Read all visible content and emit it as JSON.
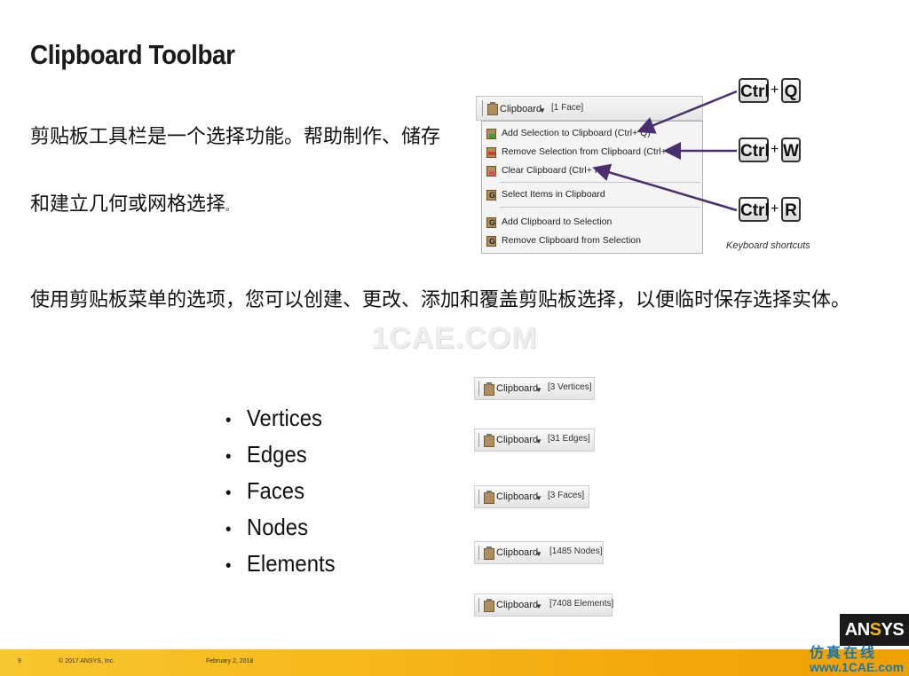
{
  "title": "Clipboard Toolbar",
  "intro_line1": "剪贴板工具栏是一个选择功能。帮助制作、储存",
  "intro_line2": "和建立几何或网格选择",
  "intro_line2_end": "。",
  "usage": "使用剪贴板菜单的选项，您可以创建、更改、添加和覆盖剪贴板选择，以便临时保存选择实体。",
  "menu": {
    "toolbar_label": "Clipboard",
    "toolbar_count": "[1 Face]",
    "items": [
      {
        "label": "Add Selection to Clipboard (Ctrl+ Q)",
        "icon": "add-clipboard-icon"
      },
      {
        "label": "Remove Selection from Clipboard (Ctrl+ W)",
        "icon": "remove-clipboard-icon"
      },
      {
        "label": "Clear Clipboard (Ctrl+ R)",
        "icon": "clear-clipboard-icon"
      },
      {
        "label": "Select Items in Clipboard",
        "icon": "select-items-icon"
      },
      {
        "label": "Add Clipboard to Selection",
        "icon": "add-to-selection-icon"
      },
      {
        "label": "Remove Clipboard from Selection",
        "icon": "remove-from-selection-icon"
      }
    ]
  },
  "shortcuts": [
    {
      "mod": "Ctrl",
      "plus": "+",
      "key": "Q"
    },
    {
      "mod": "Ctrl",
      "plus": "+",
      "key": "W"
    },
    {
      "mod": "Ctrl",
      "plus": "+",
      "key": "R"
    }
  ],
  "shortcuts_caption": "Keyboard shortcuts",
  "watermark": "1CAE.COM",
  "bullets": [
    "Vertices",
    "Edges",
    "Faces",
    "Nodes",
    "Elements"
  ],
  "mini_toolbars": [
    {
      "label": "Clipboard",
      "count": "[3 Vertices]"
    },
    {
      "label": "Clipboard",
      "count": "[31 Edges]"
    },
    {
      "label": "Clipboard",
      "count": "[3 Faces]"
    },
    {
      "label": "Clipboard",
      "count": "[1485 Nodes]"
    },
    {
      "label": "Clipboard",
      "count": "[7408 Elements]"
    }
  ],
  "footer": {
    "page": "9",
    "copyright": "© 2017 ANSYS, Inc.",
    "date": "February 2, 2018"
  },
  "logo": {
    "prefix": "AN",
    "mark": "S",
    "suffix": "YS"
  },
  "site_cn": "仿真在线",
  "site_url": "www.1CAE.com"
}
